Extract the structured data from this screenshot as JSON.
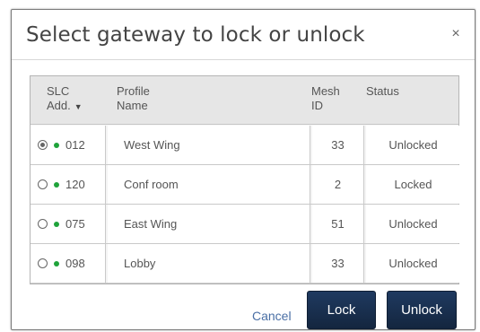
{
  "dialog": {
    "title": "Select gateway to lock or unlock",
    "close_glyph": "×"
  },
  "table": {
    "headers": {
      "slc_line1": "SLC",
      "slc_line2": "Add.",
      "sort_glyph": "▼",
      "profile_line1": "Profile",
      "profile_line2": "Name",
      "mesh_line1": "Mesh",
      "mesh_line2": "ID",
      "status": "Status"
    },
    "rows": [
      {
        "selected": true,
        "slc": "012",
        "profile": "West Wing",
        "mesh": "33",
        "status": "Unlocked"
      },
      {
        "selected": false,
        "slc": "120",
        "profile": "Conf room",
        "mesh": "2",
        "status": "Locked"
      },
      {
        "selected": false,
        "slc": "075",
        "profile": "East Wing",
        "mesh": "51",
        "status": "Unlocked"
      },
      {
        "selected": false,
        "slc": "098",
        "profile": "Lobby",
        "mesh": "33",
        "status": "Unlocked"
      }
    ]
  },
  "actions": {
    "cancel": "Cancel",
    "lock": "Lock",
    "unlock": "Unlock"
  },
  "colors": {
    "online_dot": "#1fa33a",
    "button_bg": "#1a2f4e",
    "cancel_link": "#4a6fa5"
  }
}
